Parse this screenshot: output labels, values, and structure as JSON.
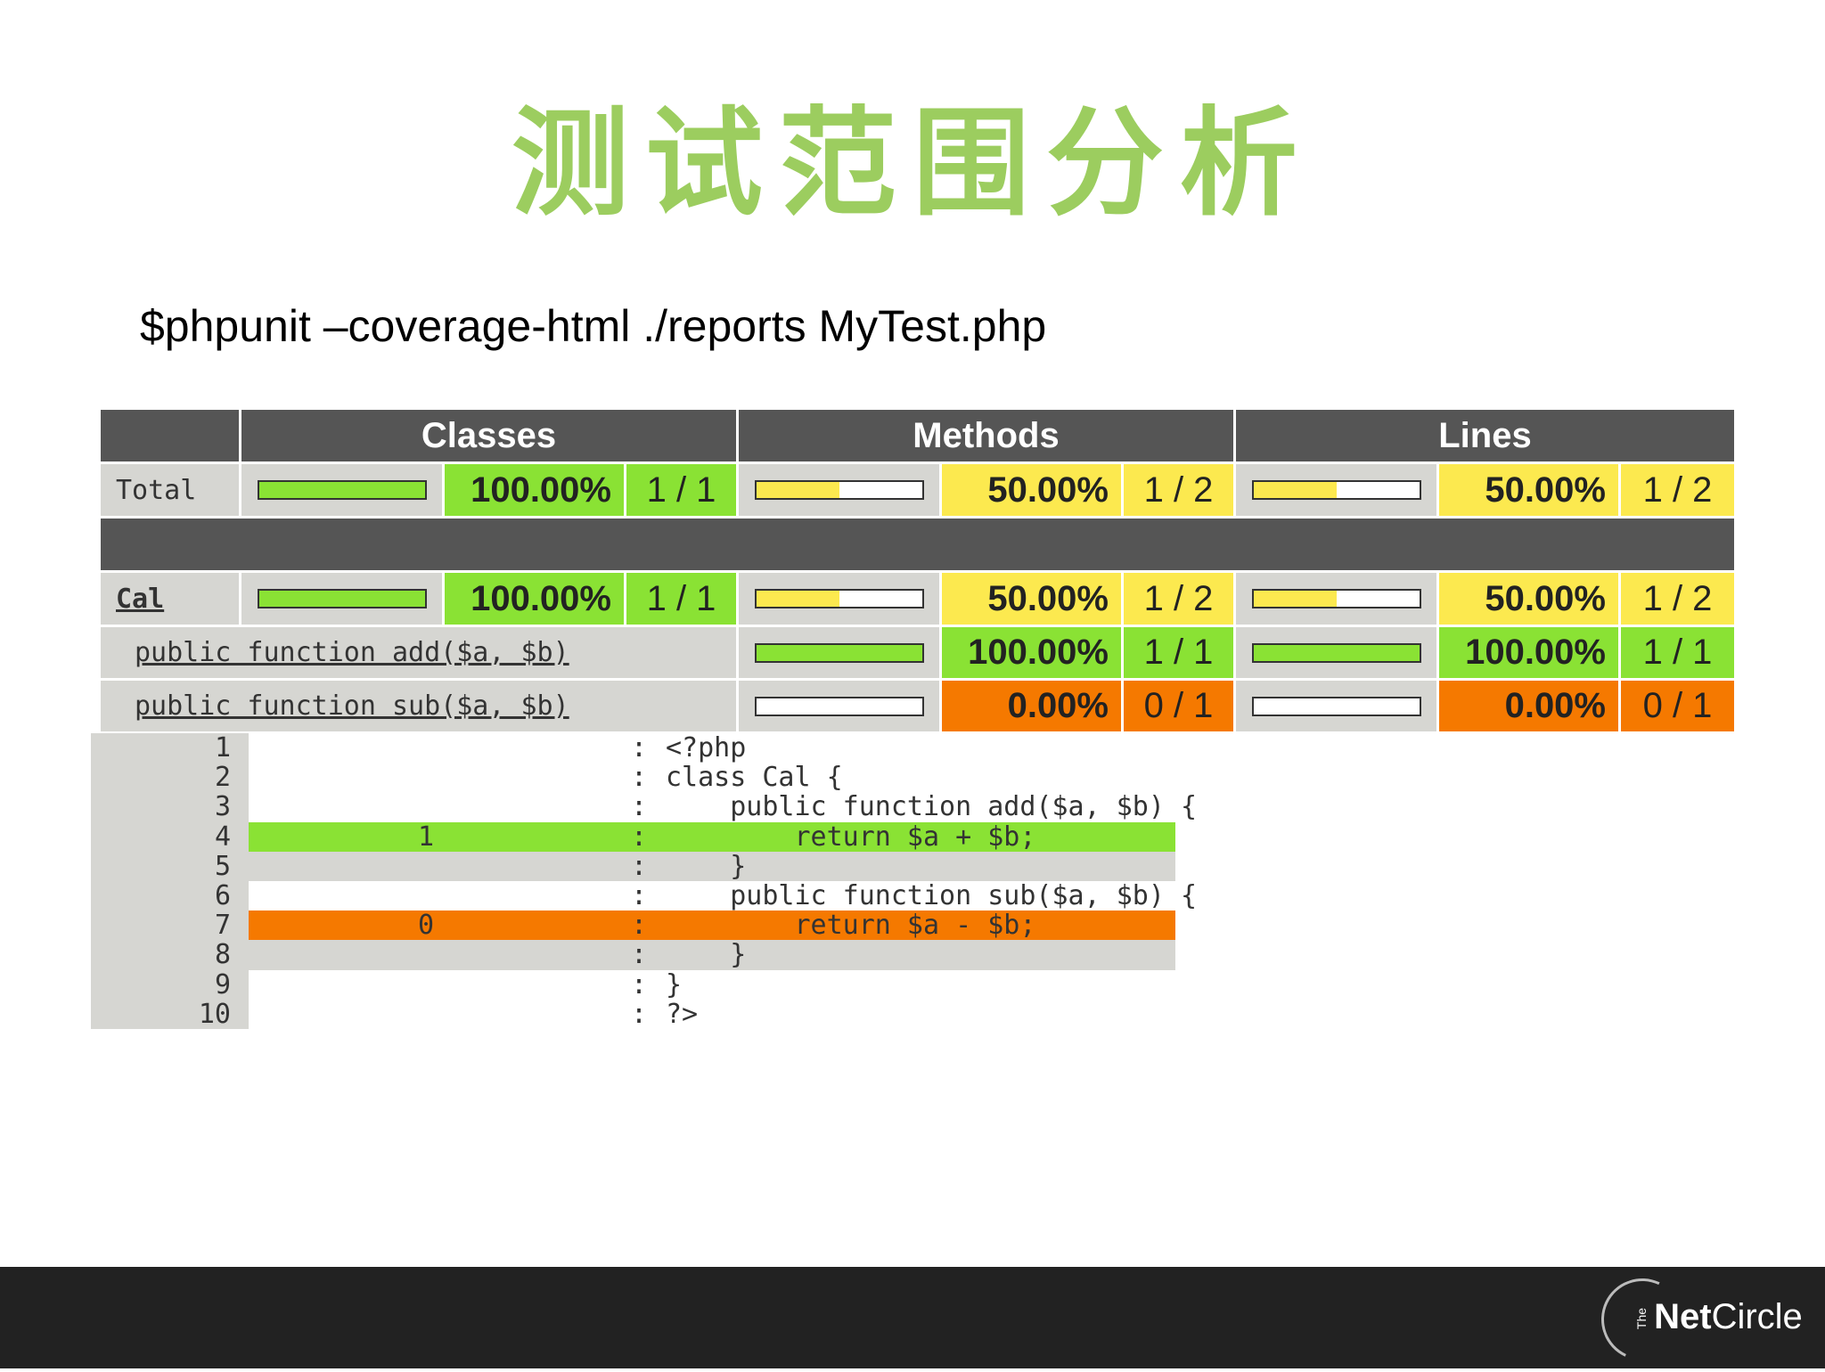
{
  "slide": {
    "title": "测试范围分析",
    "command": "$phpunit –coverage-html ./reports MyTest.php"
  },
  "coverage": {
    "headers": {
      "classes": "Classes",
      "methods": "Methods",
      "lines": "Lines"
    },
    "colors": {
      "green": "#8ae234",
      "yellow": "#fce94f",
      "orange": "#f57900",
      "header": "#555555",
      "cell": "#d6d6d2"
    },
    "total": {
      "name": "Total",
      "classes": {
        "fraction": 1.0,
        "pct": "100.00%",
        "count": "1 / 1"
      },
      "methods": {
        "fraction": 0.5,
        "pct": "50.00%",
        "count": "1 / 2"
      },
      "lines": {
        "fraction": 0.5,
        "pct": "50.00%",
        "count": "1 / 2"
      }
    },
    "class_row": {
      "name": "Cal",
      "classes": {
        "fraction": 1.0,
        "pct": "100.00%",
        "count": "1 / 1"
      },
      "methods": {
        "fraction": 0.5,
        "pct": "50.00%",
        "count": "1 / 2"
      },
      "lines": {
        "fraction": 0.5,
        "pct": "50.00%",
        "count": "1 / 2"
      }
    },
    "method_rows": [
      {
        "name": "public function add($a, $b)",
        "methods": {
          "fraction": 1.0,
          "pct": "100.00%",
          "count": "1 / 1"
        },
        "lines": {
          "fraction": 1.0,
          "pct": "100.00%",
          "count": "1 / 1"
        }
      },
      {
        "name": "public function sub($a, $b)",
        "methods": {
          "fraction": 0.0,
          "pct": "0.00%",
          "count": "0 / 1"
        },
        "lines": {
          "fraction": 0.0,
          "pct": "0.00%",
          "count": "0 / 1"
        }
      }
    ]
  },
  "code": {
    "separator": ":",
    "lines": [
      {
        "no": "1",
        "count": "",
        "text": "<?php",
        "status": "none"
      },
      {
        "no": "2",
        "count": "",
        "text": "class Cal {",
        "status": "none"
      },
      {
        "no": "3",
        "count": "",
        "text": "    public function add($a, $b) {",
        "status": "none"
      },
      {
        "no": "4",
        "count": "1",
        "text": "        return $a + $b;",
        "status": "covered"
      },
      {
        "no": "5",
        "count": "",
        "text": "    }",
        "status": "dead"
      },
      {
        "no": "6",
        "count": "",
        "text": "    public function sub($a, $b) {",
        "status": "none"
      },
      {
        "no": "7",
        "count": "0",
        "text": "        return $a - $b;",
        "status": "uncovered"
      },
      {
        "no": "8",
        "count": "",
        "text": "    }",
        "status": "dead"
      },
      {
        "no": "9",
        "count": "",
        "text": "}",
        "status": "none"
      },
      {
        "no": "10",
        "count": "",
        "text": "?>",
        "status": "none"
      }
    ]
  },
  "footer": {
    "logo_the": "The",
    "logo_net": "Net",
    "logo_circle": "Circle"
  }
}
